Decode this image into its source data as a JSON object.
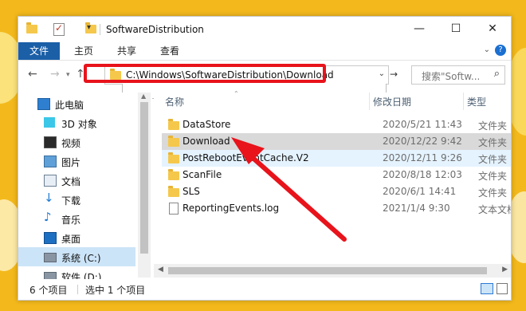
{
  "window": {
    "title": "SoftwareDistribution",
    "controls": {
      "minimize": "—",
      "maximize": "☐",
      "close": "✕"
    }
  },
  "ribbon": {
    "file": "文件",
    "home": "主页",
    "share": "共享",
    "view": "查看"
  },
  "address": {
    "path": "C:\\Windows\\SoftwareDistribution\\Download",
    "search_placeholder": "搜索\"Softw..."
  },
  "nav_pane": {
    "items": [
      {
        "label": "此电脑",
        "icon": "computer-icon"
      },
      {
        "label": "3D 对象",
        "icon": "3d-objects-icon"
      },
      {
        "label": "视频",
        "icon": "video-icon"
      },
      {
        "label": "图片",
        "icon": "pictures-icon"
      },
      {
        "label": "文档",
        "icon": "documents-icon"
      },
      {
        "label": "下载",
        "icon": "download-icon"
      },
      {
        "label": "音乐",
        "icon": "music-icon"
      },
      {
        "label": "桌面",
        "icon": "desktop-icon"
      },
      {
        "label": "系统 (C:)",
        "icon": "drive-icon"
      },
      {
        "label": "软件 (D:)",
        "icon": "drive-icon"
      }
    ]
  },
  "columns": {
    "name": "名称",
    "date": "修改日期",
    "type": "类型"
  },
  "files": [
    {
      "name": "DataStore",
      "date": "2020/5/21 11:43",
      "type": "文件夹",
      "icon": "folder-icon"
    },
    {
      "name": "Download",
      "date": "2020/12/22 9:42",
      "type": "文件夹",
      "icon": "folder-icon"
    },
    {
      "name": "PostRebootEventCache.V2",
      "date": "2020/12/11 9:26",
      "type": "文件夹",
      "icon": "folder-icon"
    },
    {
      "name": "ScanFile",
      "date": "2020/8/18 12:03",
      "type": "文件夹",
      "icon": "folder-icon"
    },
    {
      "name": "SLS",
      "date": "2020/6/1 14:41",
      "type": "文件夹",
      "icon": "folder-icon"
    },
    {
      "name": "ReportingEvents.log",
      "date": "2021/1/4 9:30",
      "type": "文本文档",
      "icon": "text-file-icon"
    }
  ],
  "status": {
    "item_count": "6 个项目",
    "selected": "选中 1 个项目"
  },
  "colors": {
    "accent": "#1b5fa7",
    "annotation_red": "#e8131b",
    "selection": "#cce8ff",
    "background": "#f3b91c"
  }
}
